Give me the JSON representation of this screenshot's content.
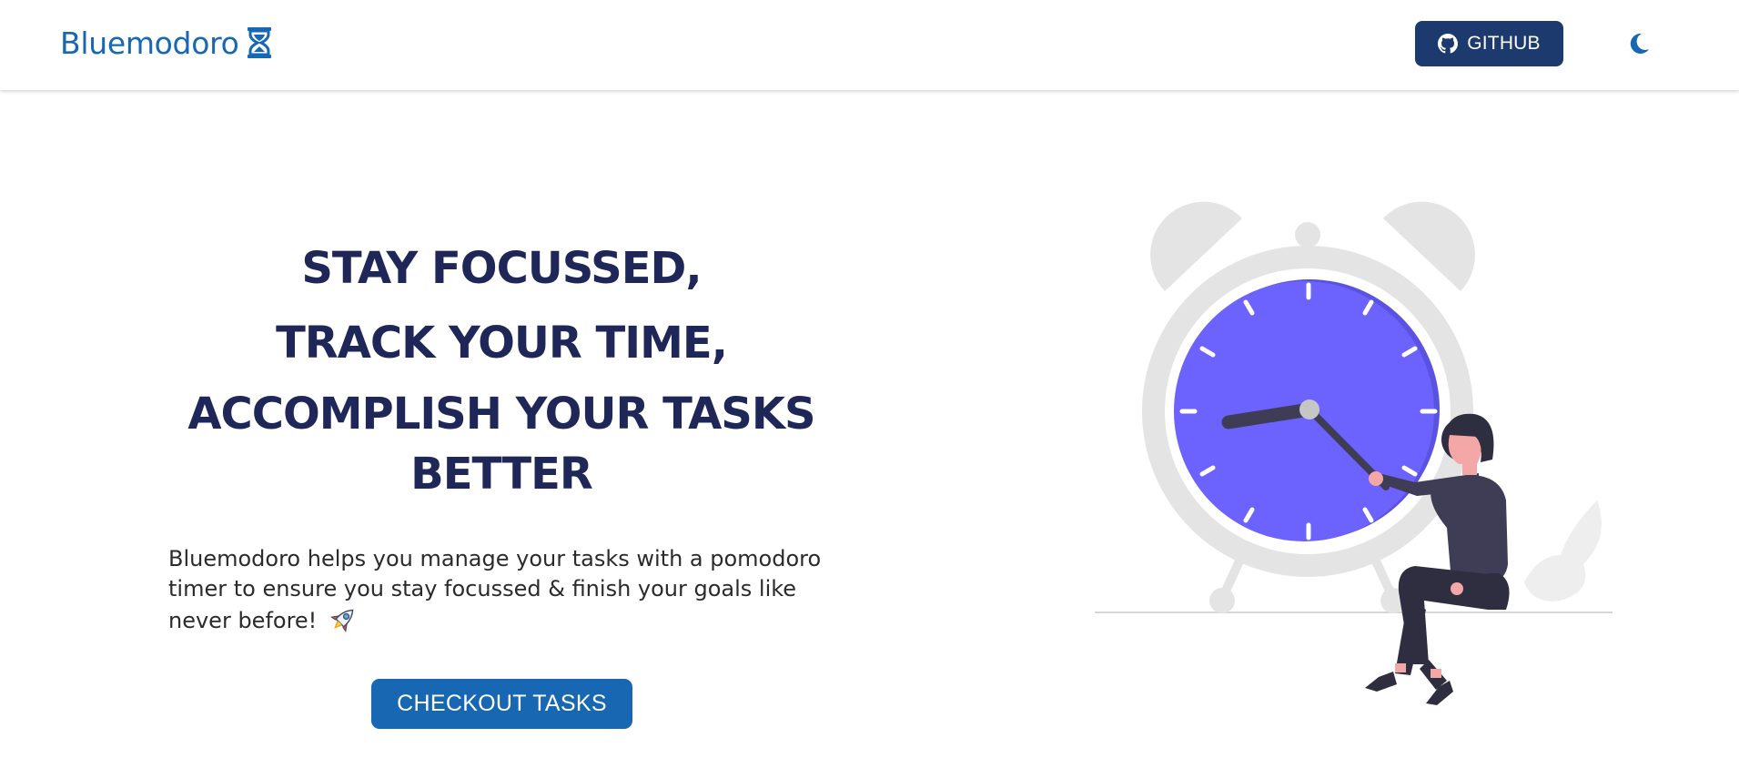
{
  "navbar": {
    "brand": "Bluemodoro",
    "brand_icon": "hourglass-icon",
    "github_label": "GITHUB",
    "github_icon": "github-icon",
    "theme_toggle_icon": "moon-icon"
  },
  "hero": {
    "heading_lines": [
      "STAY FOCUSSED,",
      "TRACK YOUR TIME,",
      "ACCOMPLISH YOUR TASKS BETTER"
    ],
    "description": "Bluemodoro helps you manage your tasks with a pomodoro timer to ensure you stay focussed & finish your goals like never before!",
    "description_emoji_icon": "rocket-icon",
    "cta_label": "CHECKOUT TASKS"
  },
  "illustration": {
    "name": "alarm-clock-woman-illustration"
  },
  "colors": {
    "brand": "#1767b2",
    "github_button": "#1c3a6e",
    "heading": "#1e2758",
    "clock_face": "#6c63ff"
  }
}
